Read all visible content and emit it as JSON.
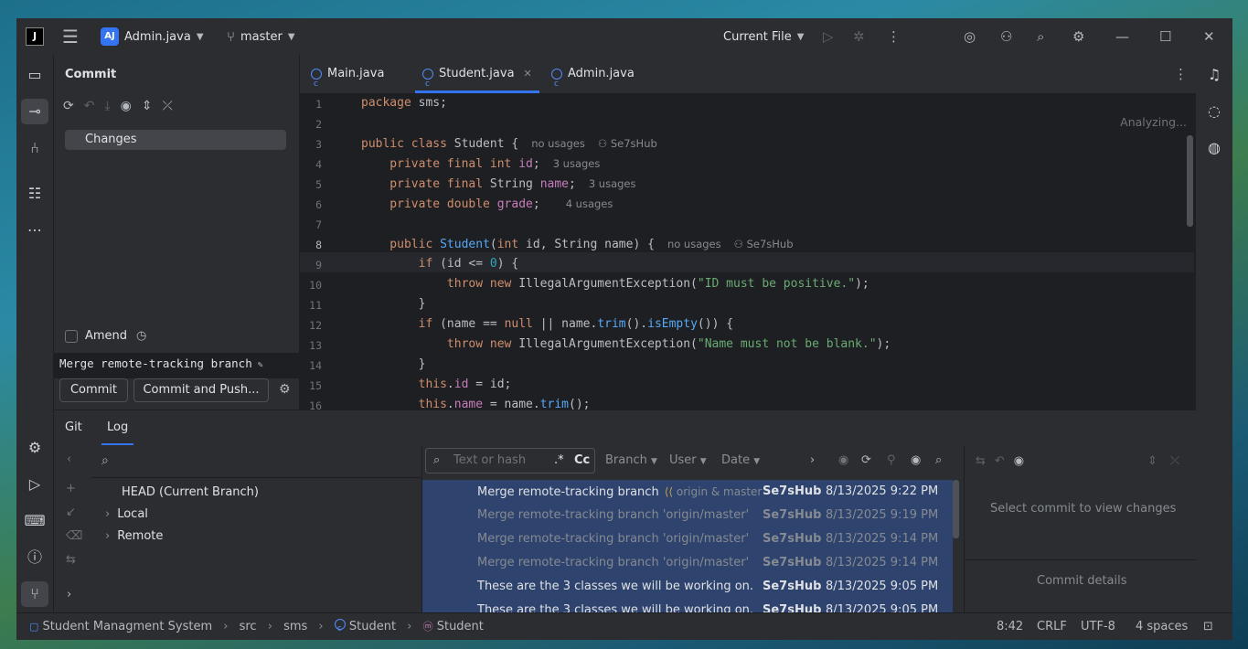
{
  "titlebar": {
    "app_icon": "jetbrains-logo",
    "project_badge": "AJ",
    "project": "Admin.java",
    "branch": "master",
    "run_config": "Current File"
  },
  "commit_panel": {
    "title": "Commit",
    "changes_label": "Changes",
    "amend_label": "Amend",
    "message": "Merge remote-tracking branch",
    "commit_button": "Commit",
    "commit_push_button": "Commit and Push..."
  },
  "editor": {
    "tabs": [
      {
        "label": "Main.java"
      },
      {
        "label": "Student.java"
      },
      {
        "label": "Admin.java"
      }
    ],
    "status": "Analyzing...",
    "line_numbers": [
      "1",
      "2",
      "3",
      "4",
      "5",
      "6",
      "7",
      "8",
      "9",
      "10",
      "11",
      "12",
      "13",
      "14",
      "15",
      "16"
    ],
    "code": {
      "l1": [
        "package",
        " sms;"
      ],
      "l3": [
        "public class",
        " Student {",
        "no usages",
        "Se7sHub"
      ],
      "l4": [
        "    private final int",
        " id",
        ";",
        "3 usages"
      ],
      "l5": [
        "    private final",
        " String ",
        "name",
        ";",
        "3 usages"
      ],
      "l6": [
        "    private double",
        " grade",
        ";",
        "4 usages"
      ],
      "l8": [
        "    public",
        " Student",
        "(",
        "int",
        " id, String name) {",
        "no usages",
        "Se7sHub"
      ],
      "l9": [
        "        if",
        " (id <= ",
        "0",
        ") {"
      ],
      "l10": [
        "            throw new",
        " IllegalArgumentException(",
        "\"ID must be positive.\"",
        ");"
      ],
      "l11": [
        "        }"
      ],
      "l12": [
        "        if",
        " (name == ",
        "null",
        " || name.",
        "trim",
        "().",
        "isEmpty",
        "()) {"
      ],
      "l13": [
        "            throw new",
        " IllegalArgumentException(",
        "\"Name must not be blank.\"",
        ");"
      ],
      "l14": [
        "        }"
      ],
      "l15": [
        "        this",
        ".",
        "id",
        " = id;"
      ],
      "l16": [
        "        this",
        ".",
        "name",
        " = name.",
        "trim",
        "();"
      ]
    }
  },
  "bottom": {
    "tabs": [
      "Git",
      "Log"
    ],
    "branches": {
      "head": "HEAD (Current Branch)",
      "local": "Local",
      "remote": "Remote"
    },
    "log": {
      "filter_placeholder": "Text or hash",
      "regex_label": ".*",
      "case_label": "Cc",
      "filters": [
        "Branch",
        "User",
        "Date"
      ],
      "rows": [
        {
          "subject": "Merge remote-tracking branch",
          "tags": "origin & master",
          "author": "Se7sHub",
          "date": "8/13/2025 9:22 PM"
        },
        {
          "subject": "Merge remote-tracking branch 'origin/master'",
          "author": "Se7sHub",
          "date": "8/13/2025 9:19 PM"
        },
        {
          "subject": "Merge remote-tracking branch 'origin/master'",
          "author": "Se7sHub",
          "date": "8/13/2025 9:14 PM"
        },
        {
          "subject": "Merge remote-tracking branch 'origin/master'",
          "author": "Se7sHub",
          "date": "8/13/2025 9:14 PM"
        },
        {
          "subject": "These are the 3 classes we will be working on.",
          "author": "Se7sHub",
          "date": "8/13/2025 9:05 PM"
        },
        {
          "subject": "These are the 3 classes we will be working on.",
          "author": "Se7sHub",
          "date": "8/13/2025 9:05 PM"
        }
      ]
    },
    "details": {
      "select_msg": "Select commit to view changes",
      "details_label": "Commit details"
    }
  },
  "statusbar": {
    "breadcrumbs": [
      "Student Managment System",
      "src",
      "sms",
      "Student",
      "Student"
    ],
    "position": "8:42",
    "line_ending": "CRLF",
    "encoding": "UTF-8",
    "indent": "4 spaces"
  },
  "colors": {
    "accent": "#3574f0",
    "keyword": "#cf8e6d",
    "field": "#c77dbb",
    "string": "#6aab73",
    "number": "#2aacb8",
    "method": "#56a8f5",
    "selection": "#2e436e"
  }
}
